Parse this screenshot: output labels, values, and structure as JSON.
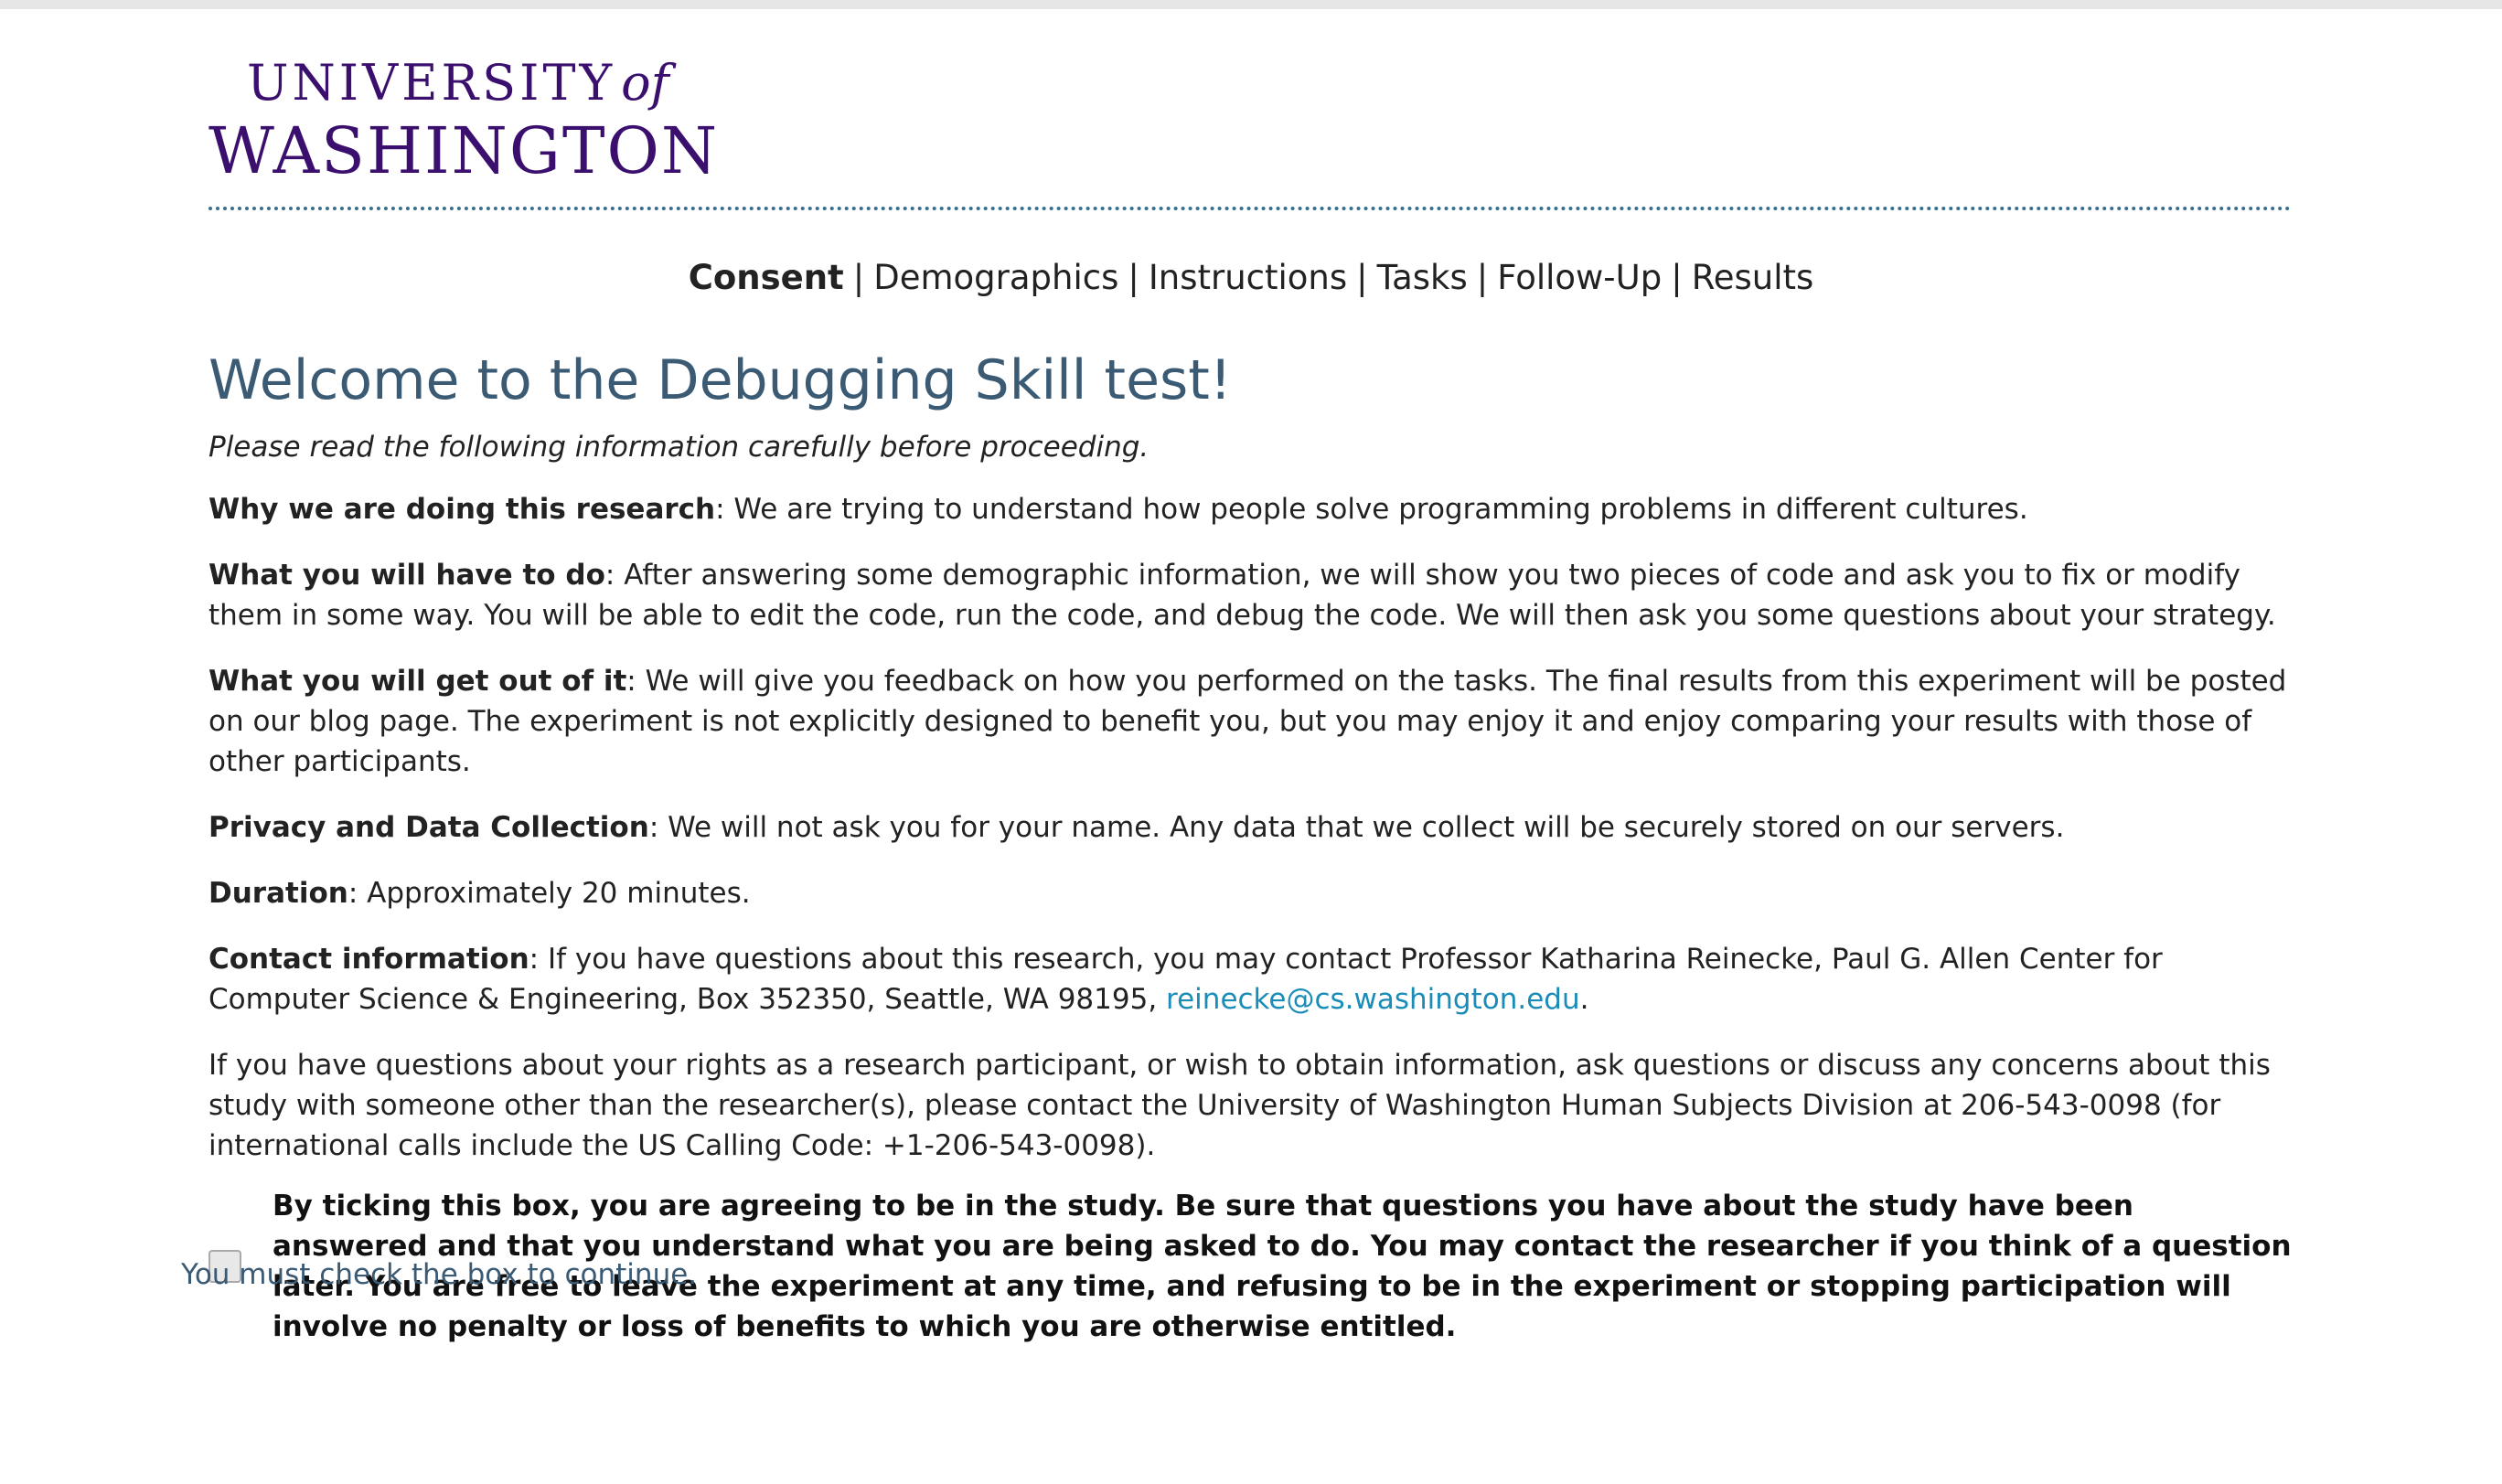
{
  "logo": {
    "line1_main": "UNIVERSITY",
    "line1_of": "of",
    "line2": "WASHINGTON"
  },
  "nav": {
    "items": [
      {
        "label": "Consent",
        "current": true
      },
      {
        "label": "Demographics",
        "current": false
      },
      {
        "label": "Instructions",
        "current": false
      },
      {
        "label": "Tasks",
        "current": false
      },
      {
        "label": "Follow-Up",
        "current": false
      },
      {
        "label": "Results",
        "current": false
      }
    ],
    "separator": "|"
  },
  "page": {
    "title": "Welcome to the Debugging Skill test!",
    "lead": "Please read the following information carefully before proceeding."
  },
  "sections": {
    "why_label": "Why we are doing this research",
    "why_text": ": We are trying to understand how people solve programming problems in different cultures.",
    "todo_label": "What you will have to do",
    "todo_text": ": After answering some demographic information, we will show you two pieces of code and ask you to fix or modify them in some way. You will be able to edit the code, run the code, and debug the code. We will then ask you some questions about your strategy.",
    "getout_label": "What you will get out of it",
    "getout_text": ": We will give you feedback on how you performed on the tasks. The final results from this experiment will be posted on our blog page. The experiment is not explicitly designed to benefit you, but you may enjoy it and enjoy comparing your results with those of other participants.",
    "privacy_label": "Privacy and Data Collection",
    "privacy_text": ": We will not ask you for your name. Any data that we collect will be securely stored on our servers.",
    "duration_label": "Duration",
    "duration_text": ": Approximately 20 minutes.",
    "contact_label": "Contact information",
    "contact_text": ": If you have questions about this research, you may contact Professor Katharina Reinecke, Paul G. Allen Center for Computer Science & Engineering, Box 352350, Seattle, WA 98195, ",
    "contact_email": "reinecke@cs.washington.edu",
    "contact_end": ".",
    "rights_text": "If you have questions about your rights as a research participant, or wish to obtain information, ask questions or discuss any concerns about this study with someone other than the researcher(s), please contact the University of Washington Human Subjects Division at 206-543-0098 (for international calls include the US Calling Code: +1-206-543-0098)."
  },
  "consent": {
    "checked": false,
    "text": "By ticking this box, you are agreeing to be in the study. Be sure that questions you have about the study have been answered and that you understand what you are being asked to do. You may contact the researcher if you think of a question later. You are free to leave the experiment at any time, and refusing to be in the experiment or stopping participation will involve no penalty or loss of benefits to which you are otherwise entitled."
  },
  "warning": "You must check the box to continue.",
  "colors": {
    "brand_purple": "#3a0f6e",
    "heading": "#3b5a74",
    "link": "#1a8cb8"
  }
}
